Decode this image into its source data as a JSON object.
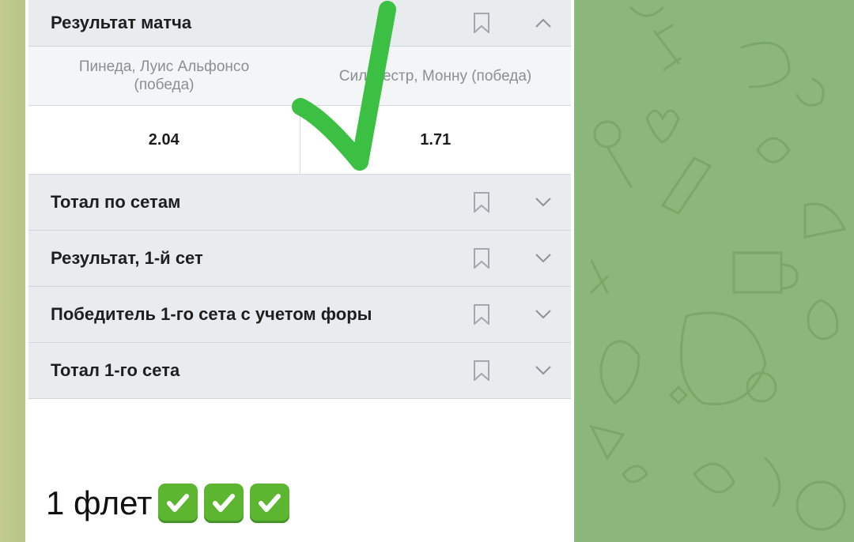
{
  "markets": {
    "match_result": {
      "title": "Результат матча",
      "outcomes": [
        {
          "name": "Пинеда, Луис Альфонсо (победа)",
          "odds": "2.04"
        },
        {
          "name": "Сильвестр, Монну (победа)",
          "odds": "1.71"
        }
      ]
    },
    "collapsed": [
      {
        "title": "Тотал по сетам"
      },
      {
        "title": "Результат, 1-й сет"
      },
      {
        "title": "Победитель 1-го сета с учетом форы"
      },
      {
        "title": "Тотал 1-го сета"
      }
    ]
  },
  "caption": {
    "text": "1 флет",
    "emoji_count": 3
  },
  "colors": {
    "check_green": "#3cc044",
    "chat_bg": "#8cb77b",
    "row_bg": "#e9ecef"
  }
}
